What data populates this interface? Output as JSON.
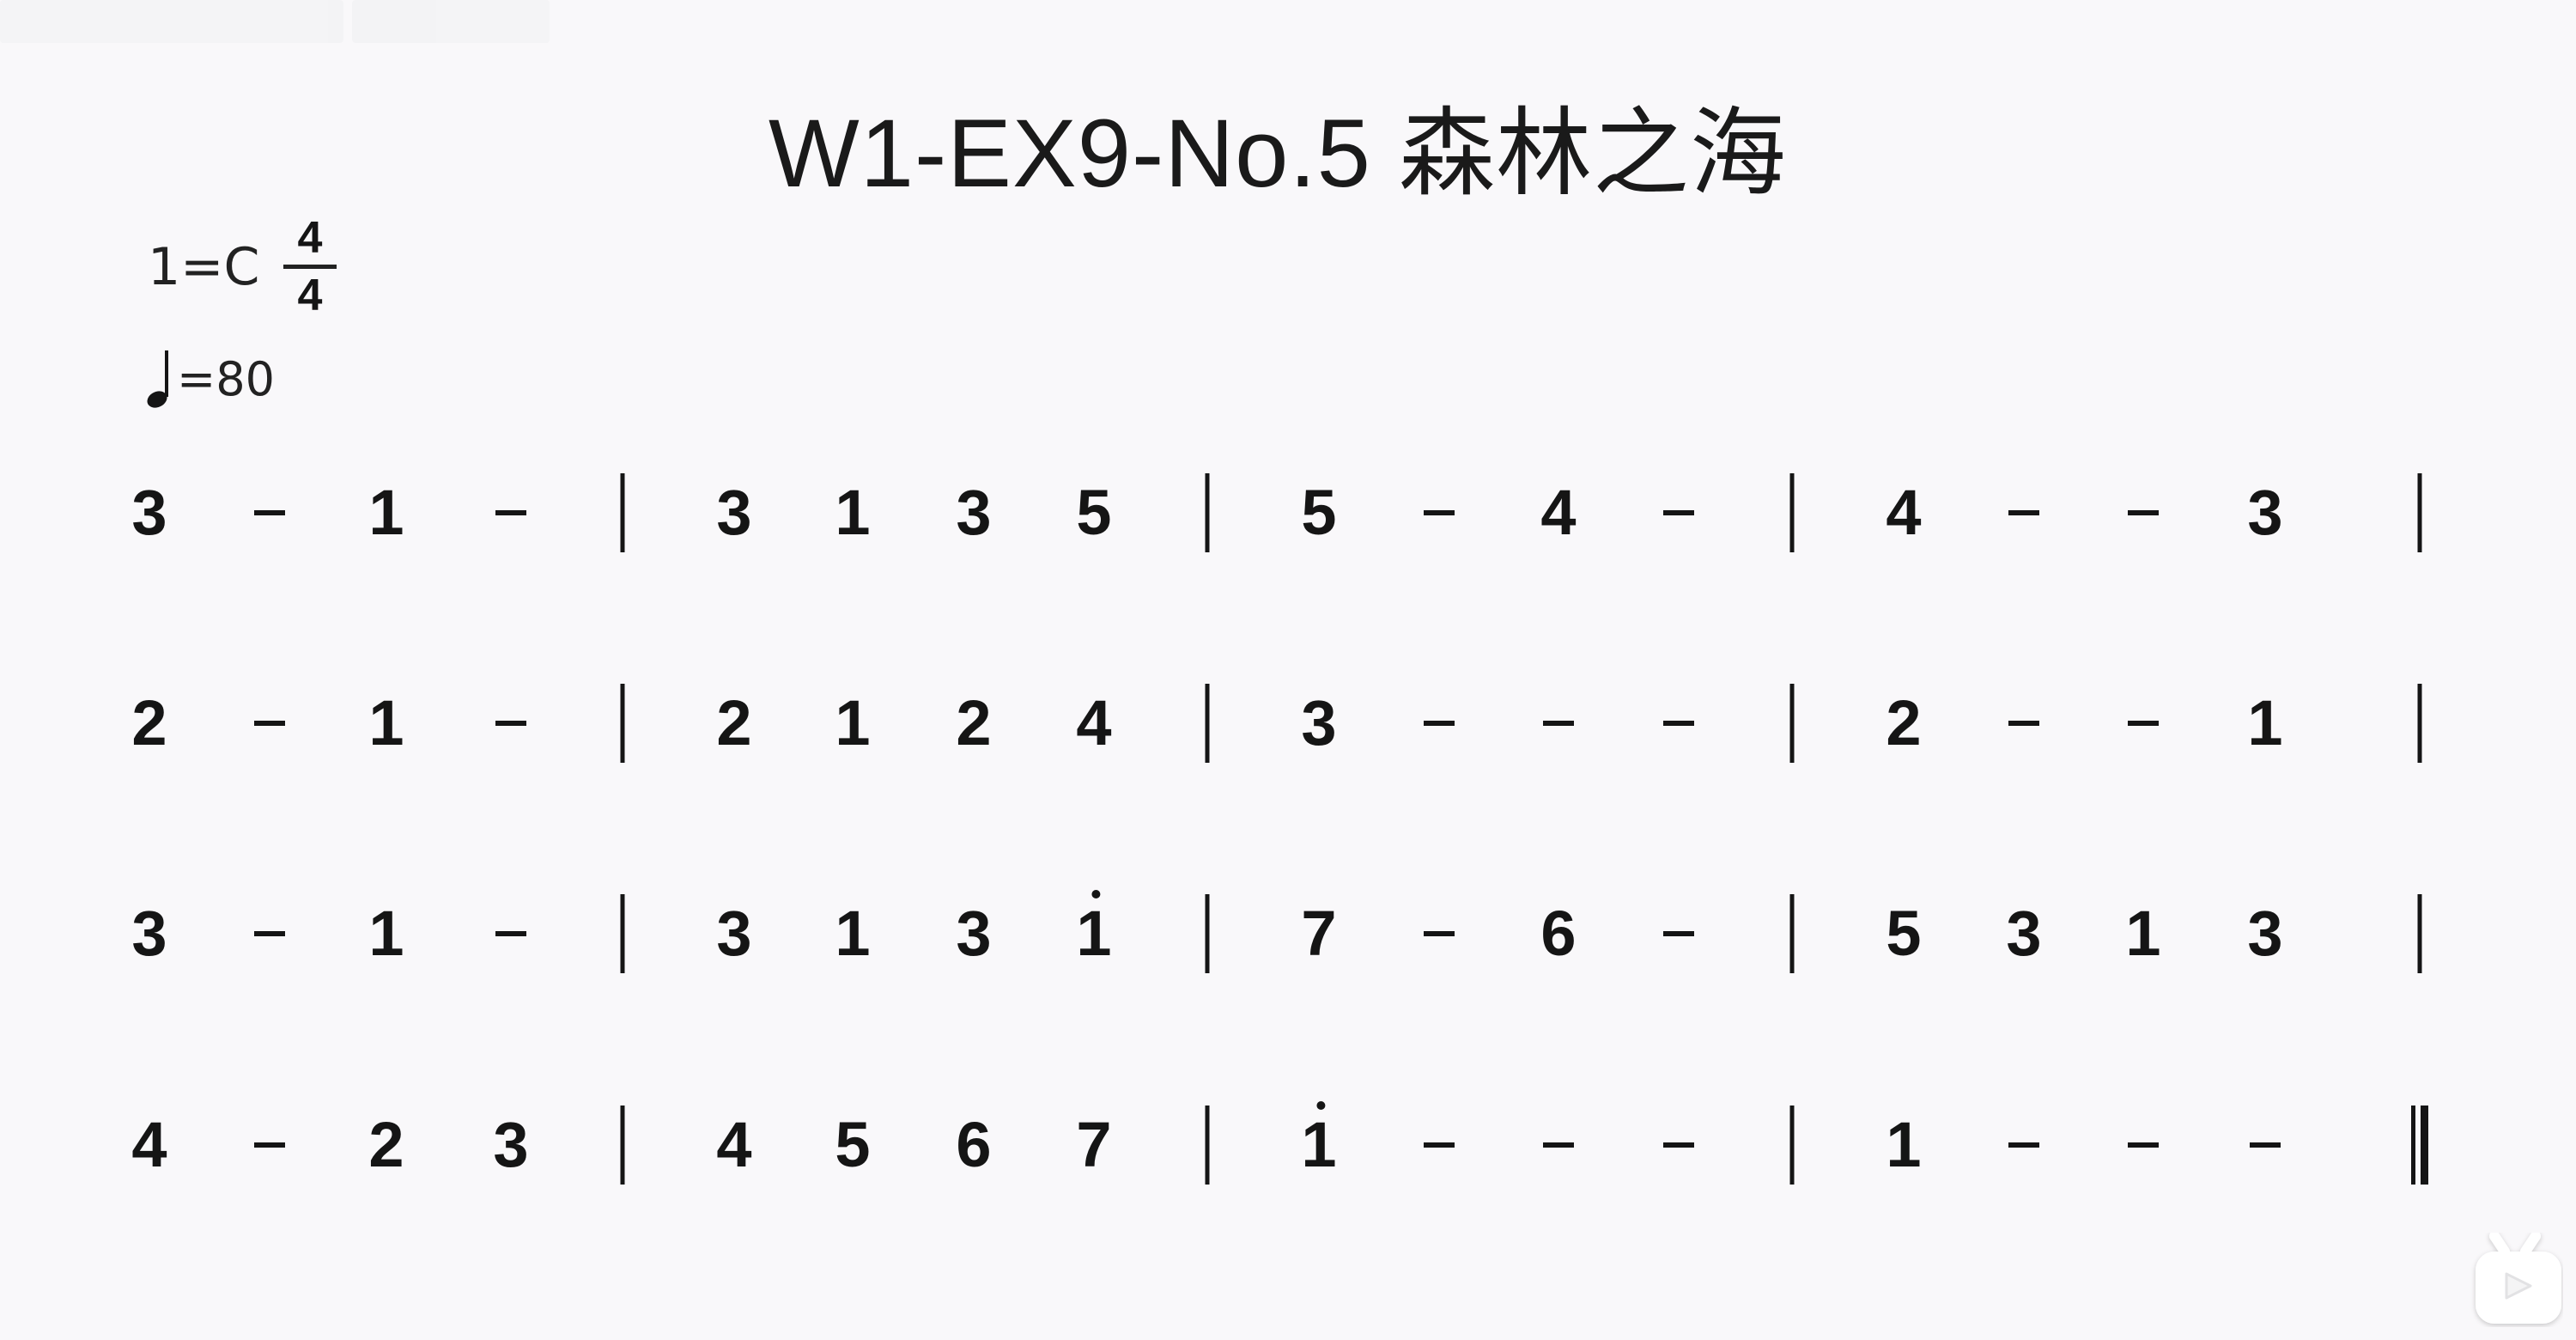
{
  "title": "W1-EX9-No.5 森林之海",
  "key": "1=C",
  "time_signature": {
    "top": "4",
    "bottom": "4"
  },
  "tempo": {
    "icon": "quarter-note-icon",
    "text": "=80"
  },
  "rows": [
    [
      [
        "3",
        "-",
        "1",
        "-"
      ],
      [
        "3",
        "1",
        "3",
        "5"
      ],
      [
        "5",
        "-",
        "4",
        "-"
      ],
      [
        "4",
        "-",
        "-",
        "3"
      ]
    ],
    [
      [
        "2",
        "-",
        "1",
        "-"
      ],
      [
        "2",
        "1",
        "2",
        "4"
      ],
      [
        "3",
        "-",
        "-",
        "-"
      ],
      [
        "2",
        "-",
        "-",
        "1"
      ]
    ],
    [
      [
        "3",
        "-",
        "1",
        "-"
      ],
      [
        "3",
        "1",
        "3",
        "1^"
      ],
      [
        "7",
        "-",
        "6",
        "-"
      ],
      [
        "5",
        "3",
        "1",
        "3"
      ]
    ],
    [
      [
        "4",
        "-",
        "2",
        "3"
      ],
      [
        "4",
        "5",
        "6",
        "7"
      ],
      [
        "1^",
        "-",
        "-",
        "-"
      ],
      [
        "1",
        "-",
        "-",
        "-"
      ]
    ]
  ],
  "watermark_icon": "bilibili-tv-icon"
}
